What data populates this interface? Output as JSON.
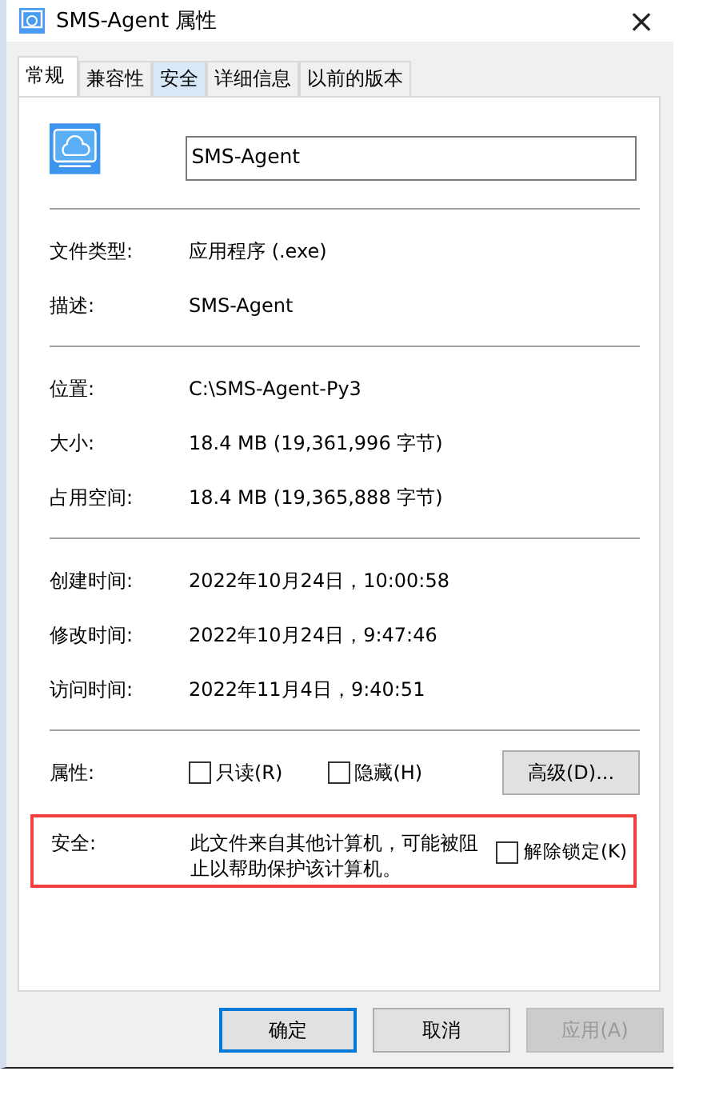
{
  "window": {
    "title": "SMS-Agent 属性",
    "close": "×"
  },
  "tabs": [
    {
      "label": "常规",
      "selected": true,
      "hovered": false
    },
    {
      "label": "兼容性",
      "selected": false,
      "hovered": false
    },
    {
      "label": "安全",
      "selected": false,
      "hovered": true
    },
    {
      "label": "详细信息",
      "selected": false,
      "hovered": false
    },
    {
      "label": "以前的版本",
      "selected": false,
      "hovered": false
    }
  ],
  "file_name": "SMS-Agent",
  "sections": [
    [
      {
        "label": "文件类型:",
        "value": "应用程序 (.exe)"
      },
      {
        "label": "描述:",
        "value": "SMS-Agent"
      }
    ],
    [
      {
        "label": "位置:",
        "value": "C:\\SMS-Agent-Py3"
      },
      {
        "label": "大小:",
        "value": "18.4 MB (19,361,996 字节)"
      },
      {
        "label": "占用空间:",
        "value": "18.4 MB (19,365,888 字节)"
      }
    ],
    [
      {
        "label": "创建时间:",
        "value": "2022年10月24日，10:00:58"
      },
      {
        "label": "修改时间:",
        "value": "2022年10月24日，9:47:46"
      },
      {
        "label": "访问时间:",
        "value": "2022年11月4日，9:40:51"
      }
    ]
  ],
  "attributes": {
    "label": "属性:",
    "options": [
      {
        "label": "只读(R)",
        "checked": false
      },
      {
        "label": "隐藏(H)",
        "checked": false
      }
    ],
    "advanced_button": "高级(D)..."
  },
  "security": {
    "label": "安全:",
    "message": "此文件来自其他计算机，可能被阻止以帮助保护该计算机。",
    "unblock": {
      "label": "解除锁定(K)",
      "checked": false
    },
    "highlighted": true
  },
  "buttons": [
    {
      "label": "确定",
      "default": true,
      "disabled": false
    },
    {
      "label": "取消",
      "default": false,
      "disabled": false
    },
    {
      "label": "应用(A)",
      "default": false,
      "disabled": true
    }
  ]
}
